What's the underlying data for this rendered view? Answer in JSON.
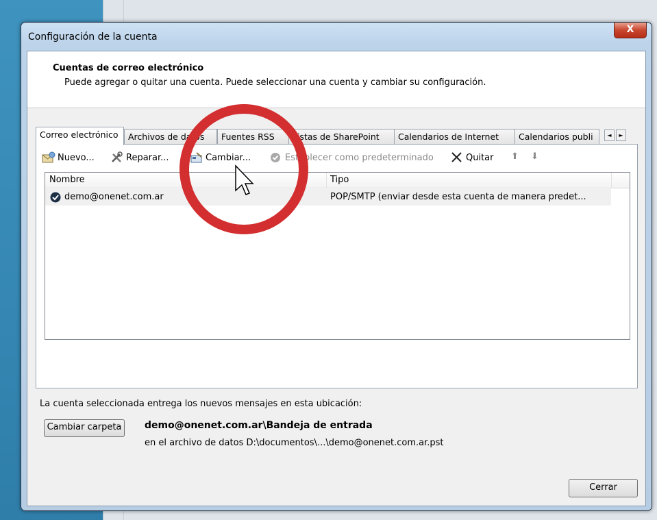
{
  "dialog": {
    "title": "Configuración de la cuenta",
    "close_glyph": "X"
  },
  "header": {
    "title": "Cuentas de correo electrónico",
    "subtitle": "Puede agregar o quitar una cuenta. Puede seleccionar una cuenta y cambiar su configuración."
  },
  "tabs": [
    {
      "label": "Correo electrónico",
      "active": true
    },
    {
      "label": "Archivos de datos"
    },
    {
      "label": "Fuentes RSS"
    },
    {
      "label": "Listas de SharePoint"
    },
    {
      "label": "Calendarios de Internet"
    },
    {
      "label": "Calendarios publi"
    }
  ],
  "tab_scroll": {
    "left": "◄",
    "right": "►"
  },
  "toolbar": {
    "new_label": "Nuevo...",
    "repair_label": "Reparar...",
    "change_label": "Cambiar...",
    "set_default_label": "Establecer como predeterminado",
    "remove_label": "Quitar",
    "up_glyph": "⬆",
    "down_glyph": "⬇"
  },
  "accounts_list": {
    "columns": [
      "Nombre",
      "Tipo"
    ],
    "rows": [
      {
        "name": "demo@onenet.com.ar",
        "type": "POP/SMTP (enviar desde esta cuenta de manera predet..."
      }
    ]
  },
  "delivery": {
    "label": "La cuenta seleccionada entrega los nuevos mensajes en esta ubicación:",
    "change_folder_label": "Cambiar carpeta",
    "folder_path": "demo@onenet.com.ar\\Bandeja de entrada",
    "data_file": "en el archivo de datos D:\\documentos\\...\\demo@onenet.com.ar.pst"
  },
  "footer": {
    "close_label": "Cerrar"
  },
  "colors": {
    "annotation_circle": "#d42f30",
    "accent": "#3d8fba"
  }
}
